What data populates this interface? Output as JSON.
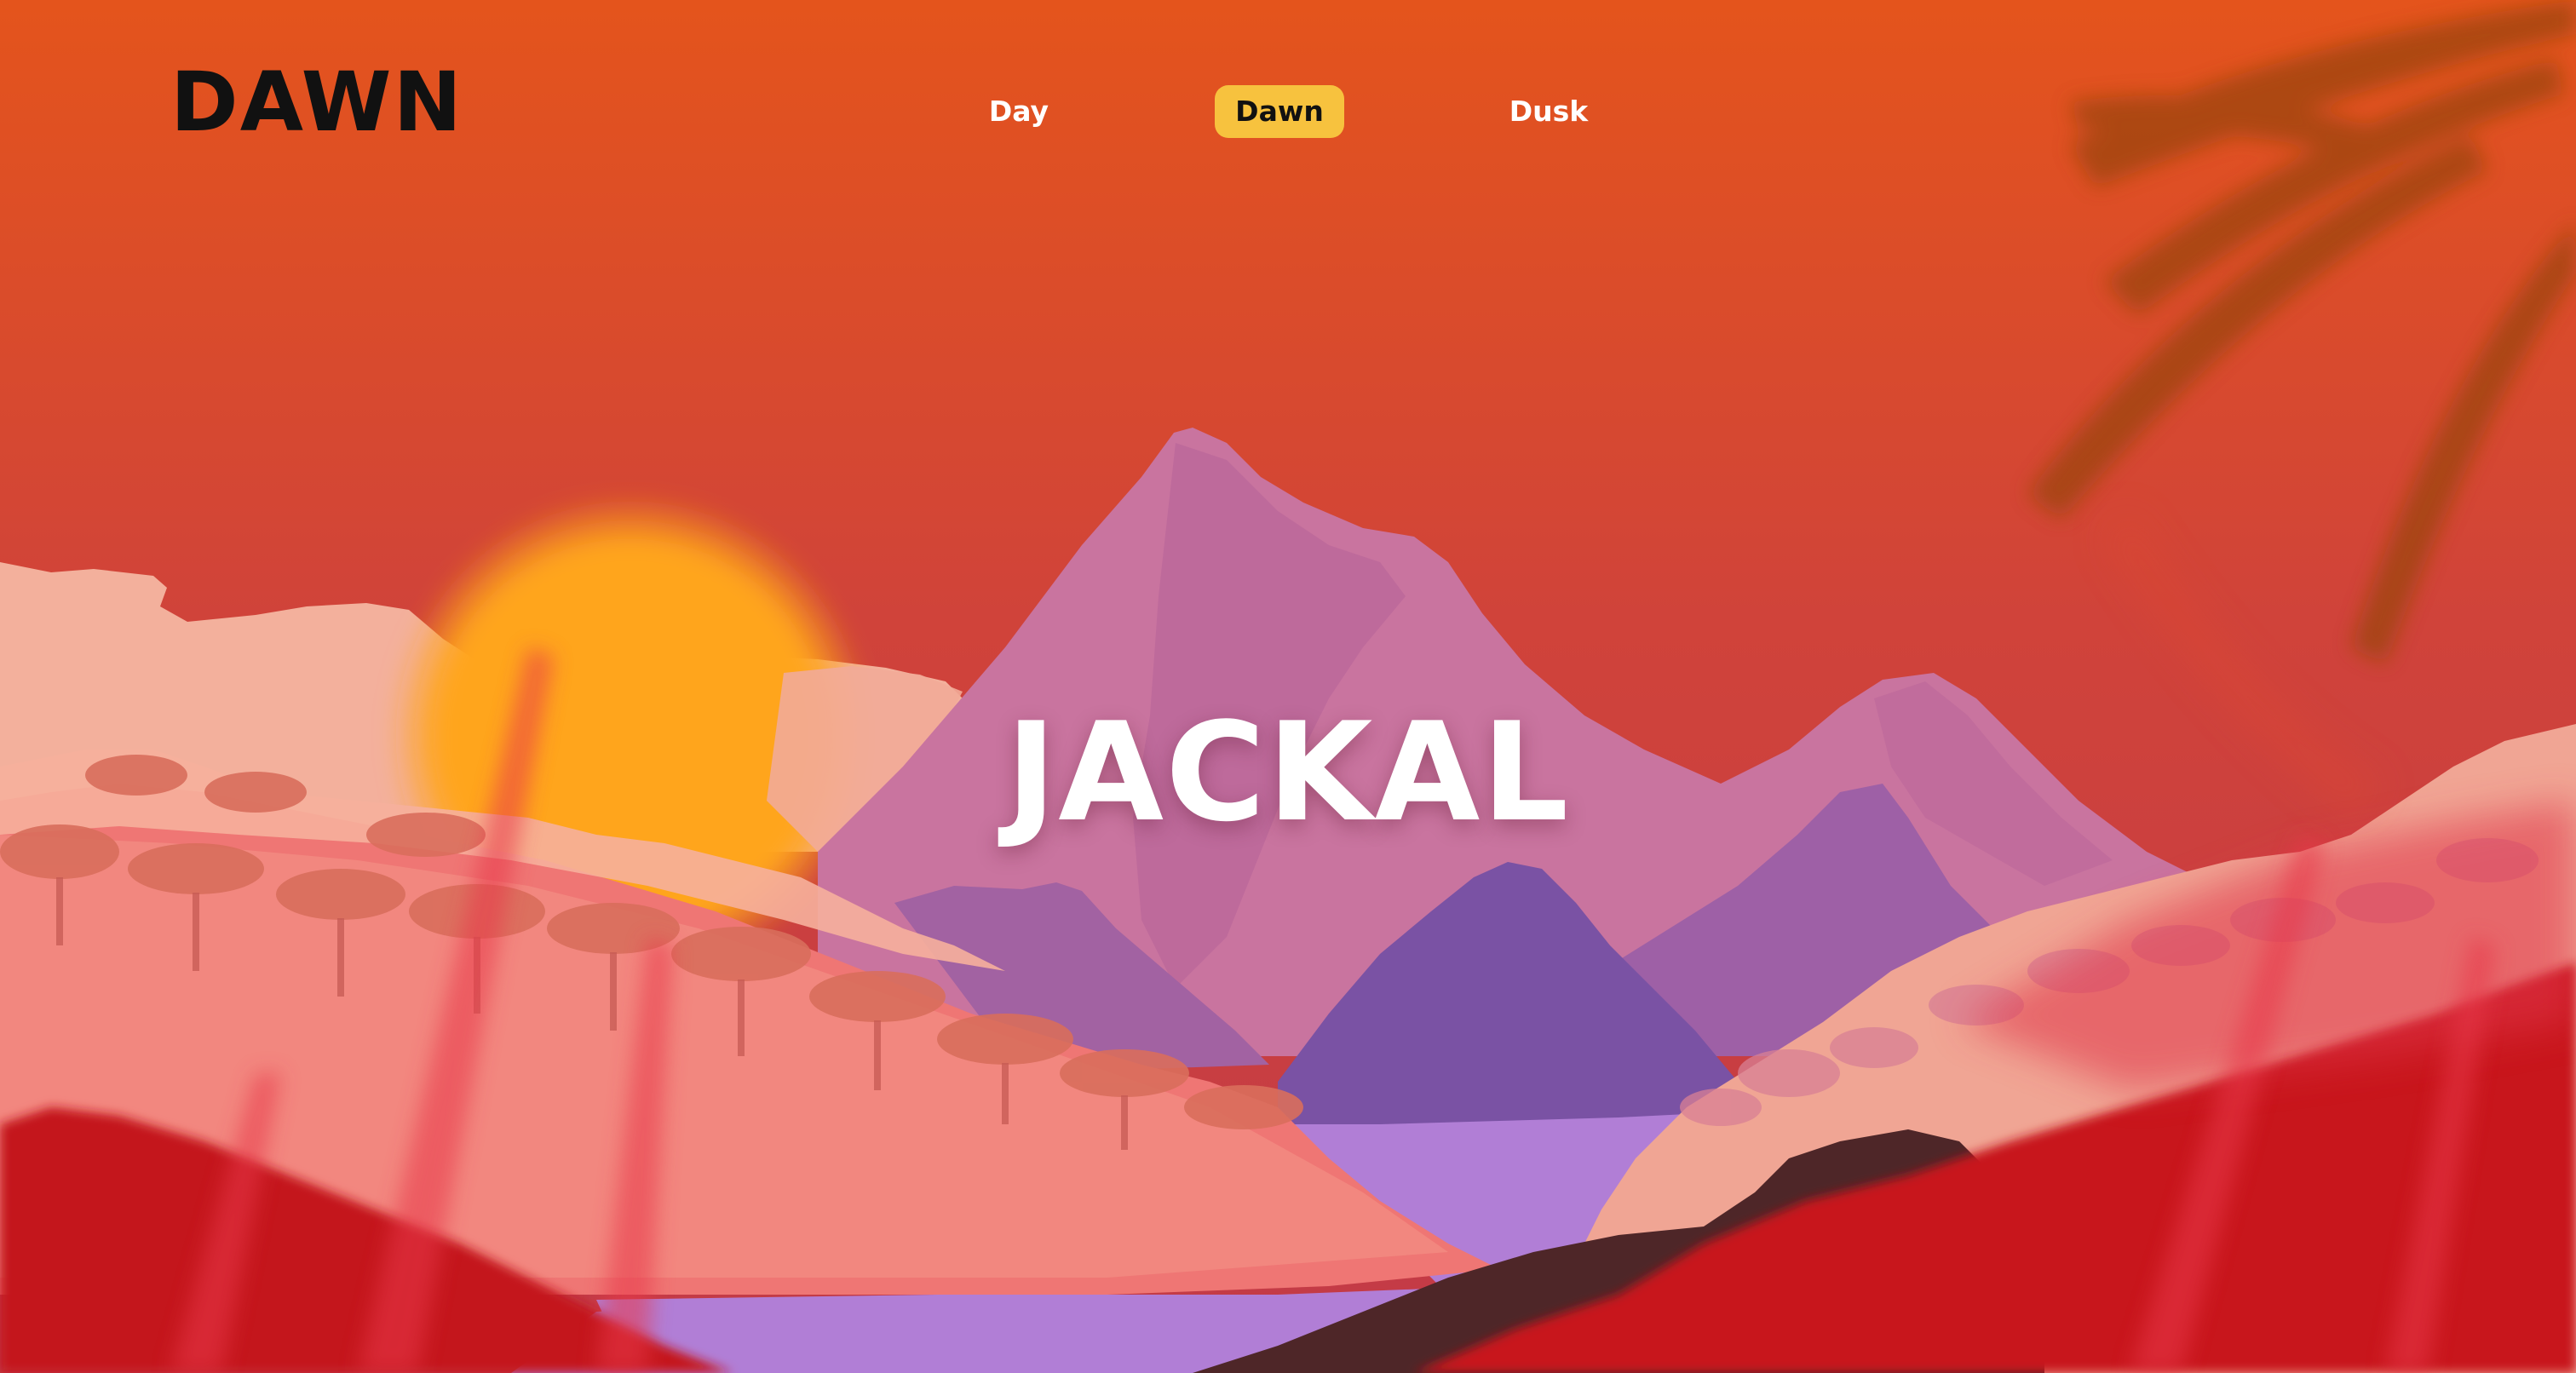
{
  "brand": {
    "logo_text": "DAWN"
  },
  "nav": {
    "items": [
      {
        "label": "Day",
        "active": false
      },
      {
        "label": "Dawn",
        "active": true
      },
      {
        "label": "Dusk",
        "active": false
      }
    ]
  },
  "hero": {
    "title": "JACKAL"
  },
  "colors": {
    "sky_top": "#e4541c",
    "sky_bottom": "#c43a46",
    "sun": "#ffa41c",
    "active_tab": "#f7c23e",
    "mountain_far": "#c872a0",
    "mountain_mid": "#9e62a2",
    "mountain_near": "#7a52a4",
    "lake": "#b07dd6",
    "foliage_light": "#f4aa96",
    "foliage": "#ee7474",
    "foreground": "#c81d24"
  }
}
